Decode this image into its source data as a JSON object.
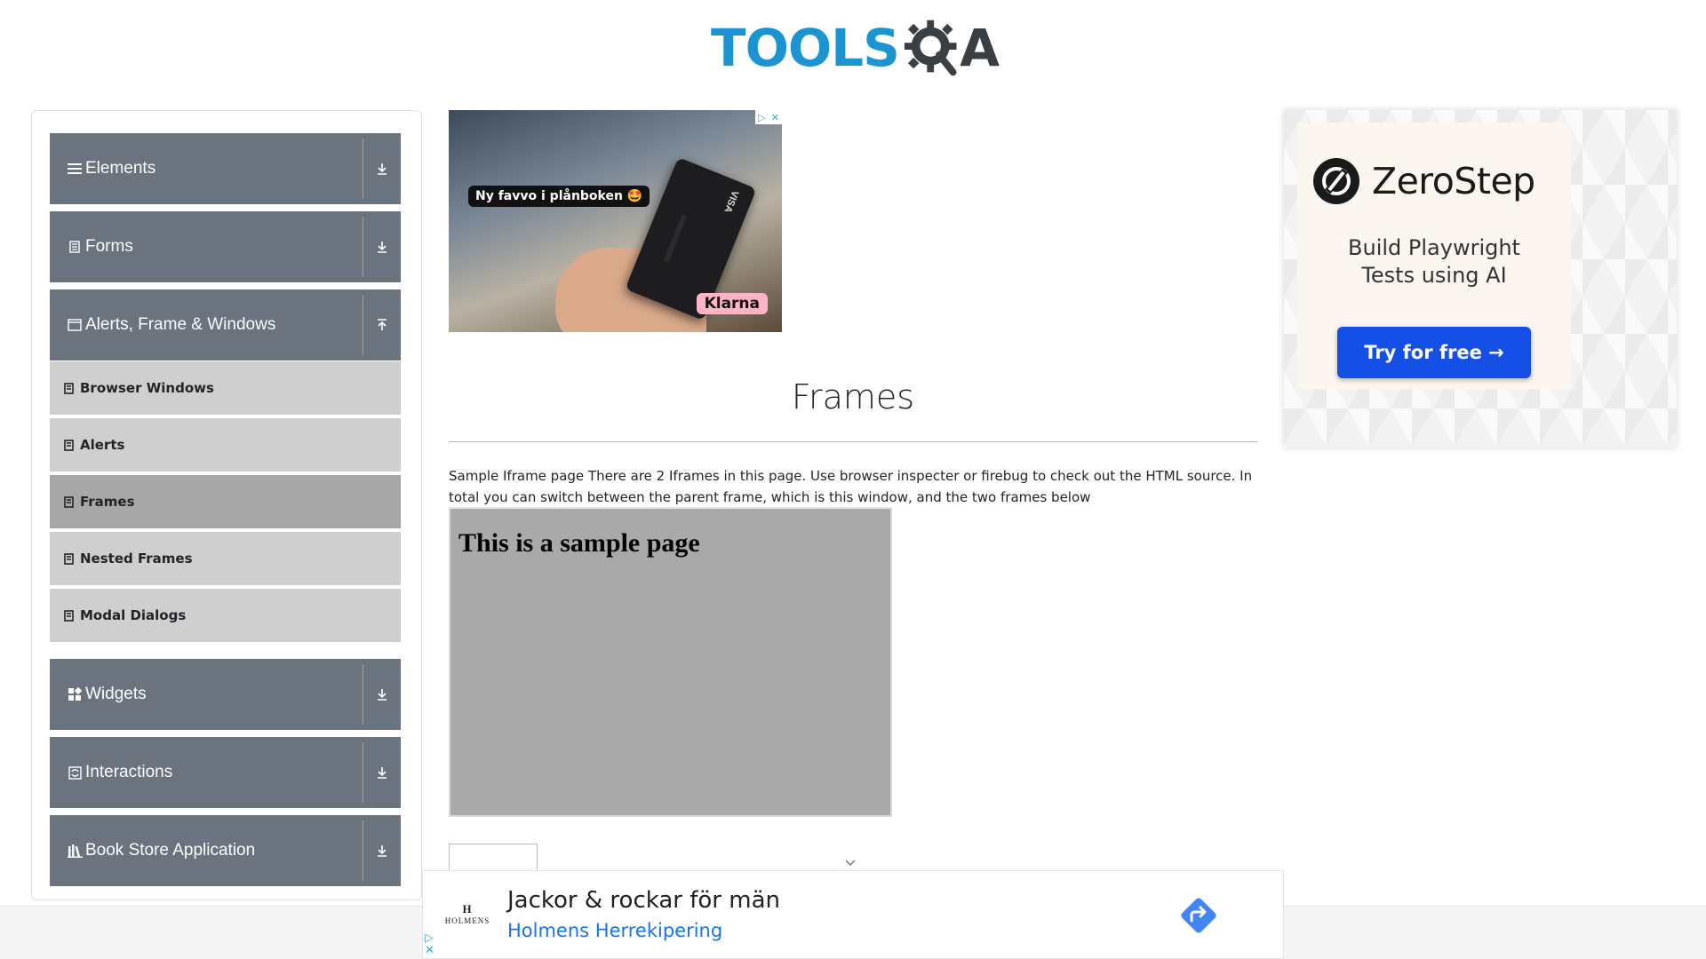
{
  "logo": {
    "text_tools": "TOOLS",
    "text_a": "A",
    "colors": {
      "tools": "#1b94d1",
      "qa": "#3a3f44"
    }
  },
  "sidebar": {
    "groups": [
      {
        "label": "Elements",
        "icon": "hamburger-icon",
        "expanded": false
      },
      {
        "label": "Forms",
        "icon": "form-icon",
        "expanded": false
      },
      {
        "label": "Alerts, Frame & Windows",
        "icon": "window-icon",
        "expanded": true
      },
      {
        "label": "Widgets",
        "icon": "widgets-icon",
        "expanded": false
      },
      {
        "label": "Interactions",
        "icon": "interactions-icon",
        "expanded": false
      },
      {
        "label": "Book Store Application",
        "icon": "books-icon",
        "expanded": false
      }
    ],
    "items": [
      {
        "label": "Browser Windows",
        "active": false
      },
      {
        "label": "Alerts",
        "active": false
      },
      {
        "label": "Frames",
        "active": true
      },
      {
        "label": "Nested Frames",
        "active": false
      },
      {
        "label": "Modal Dialogs",
        "active": false
      }
    ],
    "colors": {
      "group_bg": "#6b737e",
      "item_bg": "#cfcfcf",
      "item_active_bg": "#a7a7a7"
    }
  },
  "ad_top": {
    "bubble_text": "Ny favvo i plånboken 🤩",
    "card_mark": "VISA",
    "brand": "Klarna"
  },
  "main": {
    "title": "Frames",
    "description": "Sample Iframe page There are 2 Iframes in this page. Use browser inspecter or firebug to check out the HTML source. In total you can switch between the parent frame, which is this window, and the two frames below",
    "frame1_text": "This is a sample page",
    "frame1_bg": "#a9a9a9"
  },
  "ad_right": {
    "brand": "ZeroStep",
    "tagline_line1": "Build Playwright",
    "tagline_line2": "Tests using AI",
    "cta": "Try for free →",
    "cta_color": "#1450e6"
  },
  "ad_bottom": {
    "logo_mono": "H",
    "logo_text": "HOLMENS",
    "headline": "Jackor & rockar för män",
    "advertiser": "Holmens Herrekipering",
    "advertiser_color": "#1a73e8"
  }
}
